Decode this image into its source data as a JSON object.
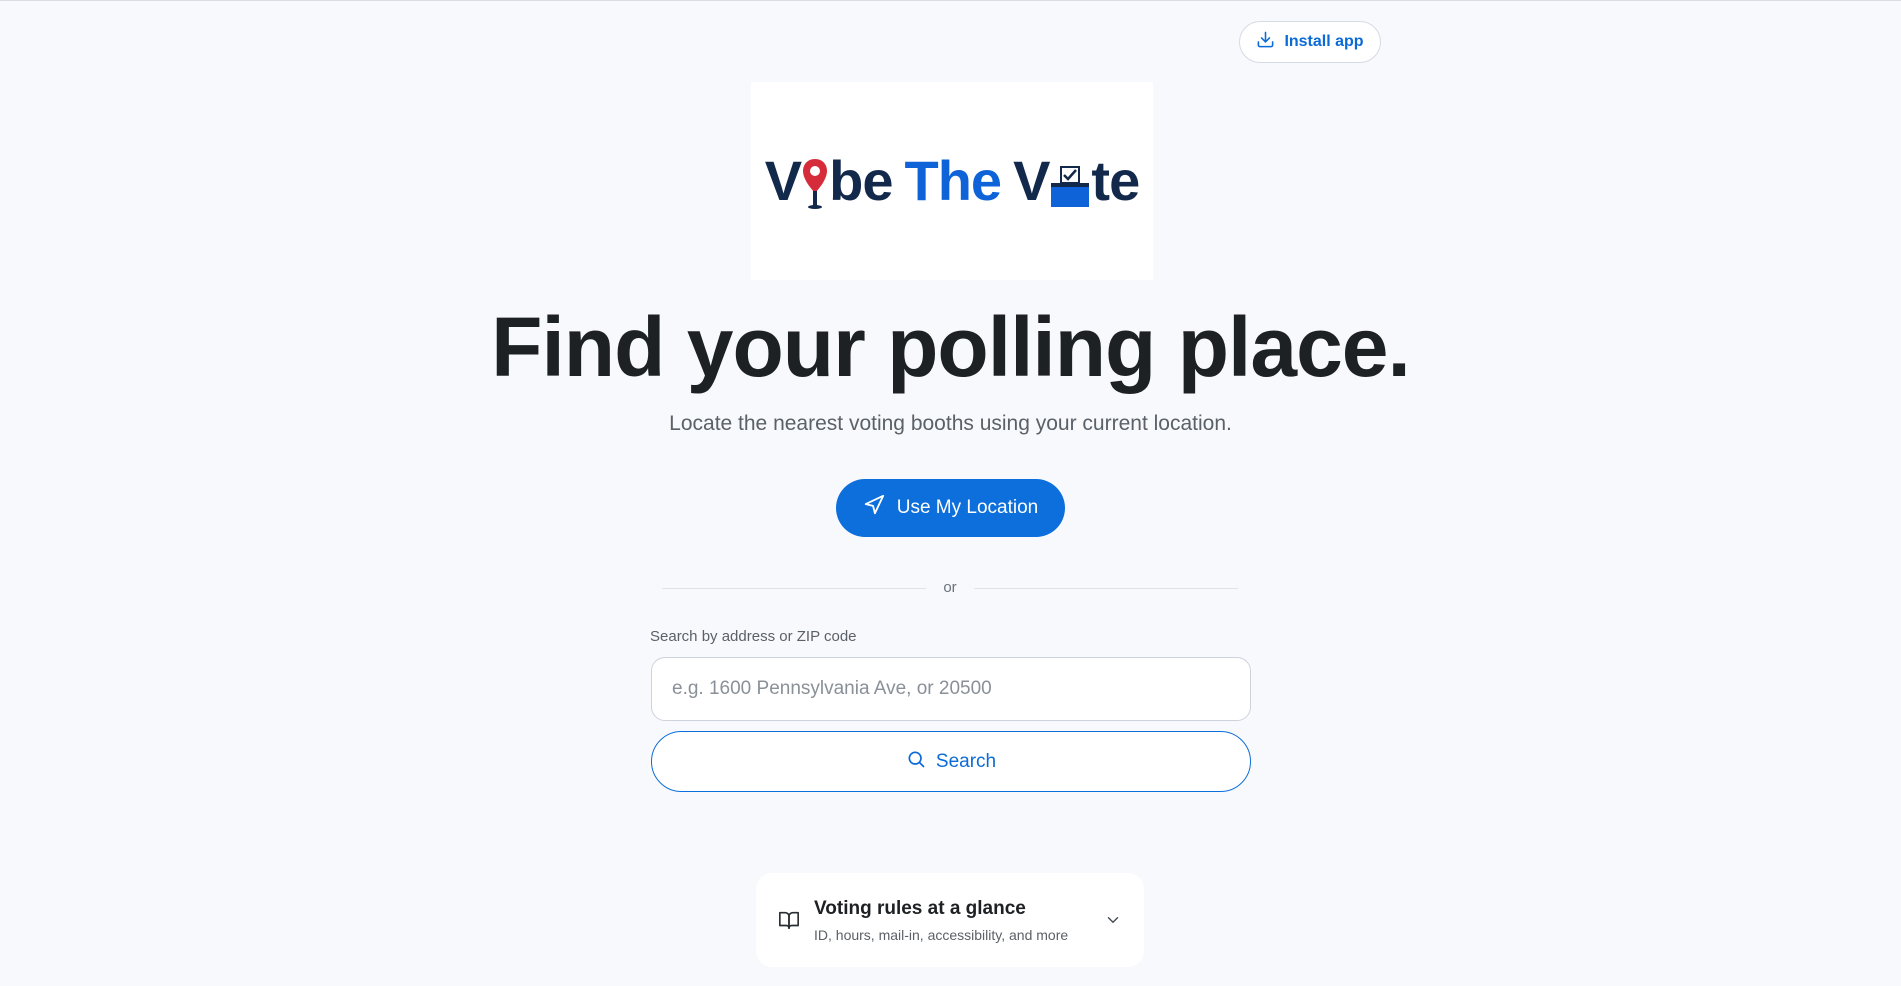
{
  "header": {
    "install_label": "Install app"
  },
  "logo": {
    "part1": "V",
    "part2": "be",
    "part3": "The",
    "part4": "V",
    "part5": "te",
    "colors": {
      "dark": "#13294b",
      "blue": "#0e63d8",
      "pin": "#d62b3a"
    }
  },
  "hero": {
    "title": "Find your polling place.",
    "subtitle": "Locate the nearest voting booths using your current location."
  },
  "location_button": {
    "label": "Use My Location"
  },
  "divider": {
    "text": "or"
  },
  "search": {
    "label": "Search by address or ZIP code",
    "placeholder": "e.g. 1600 Pennsylvania Ave, or 20500",
    "value": "",
    "button_label": "Search"
  },
  "rules_card": {
    "title": "Voting rules at a glance",
    "subtitle": "ID, hours, mail-in, accessibility, and more"
  },
  "icons": {
    "install": "download-icon",
    "location": "navigation-arrow-icon",
    "search": "search-icon",
    "rules": "open-book-icon",
    "expand": "chevron-down-icon"
  },
  "colors": {
    "accent": "#0d6fdb",
    "background": "#f8f9fc"
  }
}
